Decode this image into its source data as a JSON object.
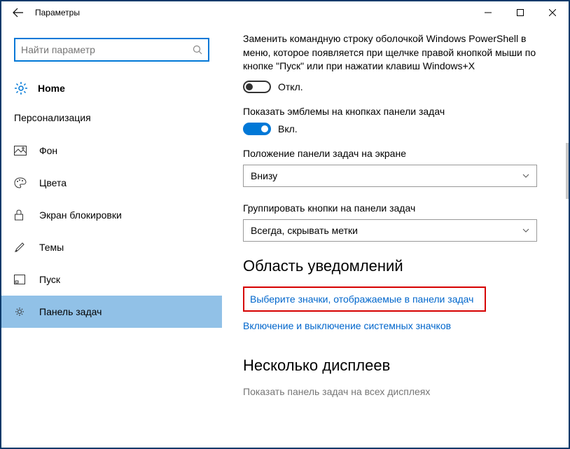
{
  "window": {
    "title": "Параметры"
  },
  "search": {
    "placeholder": "Найти параметр"
  },
  "home": {
    "label": "Home"
  },
  "sidebar": {
    "category": "Персонализация",
    "items": [
      {
        "label": "Фон",
        "icon": "picture-icon"
      },
      {
        "label": "Цвета",
        "icon": "palette-icon"
      },
      {
        "label": "Экран блокировки",
        "icon": "lock-icon"
      },
      {
        "label": "Темы",
        "icon": "brush-icon"
      },
      {
        "label": "Пуск",
        "icon": "start-icon"
      },
      {
        "label": "Панель задач",
        "icon": "taskbar-icon"
      }
    ]
  },
  "content": {
    "powershell_desc": "Заменить командную строку оболочкой Windows PowerShell в меню, которое появляется при щелчке правой кнопкой мыши по кнопке \"Пуск\" или при нажатии клавиш Windows+X",
    "toggle_off": "Откл.",
    "badges_label": "Показать эмблемы на кнопках панели задач",
    "toggle_on": "Вкл.",
    "position_label": "Положение панели задач на экране",
    "position_value": "Внизу",
    "combine_label": "Группировать кнопки на панели задач",
    "combine_value": "Всегда, скрывать метки",
    "notification_title": "Область уведомлений",
    "link1": "Выберите значки, отображаемые в панели задач",
    "link2": "Включение и выключение системных значков",
    "displays_title": "Несколько дисплеев",
    "displays_desc": "Показать панель задач на всех дисплеях"
  }
}
